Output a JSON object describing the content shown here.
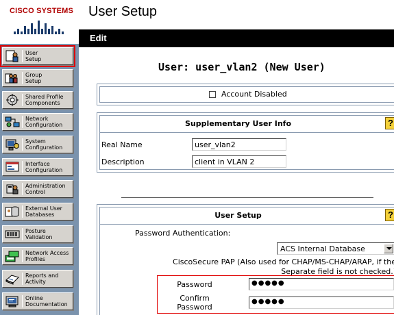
{
  "app": {
    "logo_text": "Cisco Systems",
    "page_title": "User Setup",
    "menu_edit": "Edit"
  },
  "sidebar": {
    "items": [
      {
        "label": "User\nSetup",
        "icon": "user-setup-icon",
        "active": true
      },
      {
        "label": "Group\nSetup",
        "icon": "group-setup-icon",
        "active": false
      },
      {
        "label": "Shared Profile\nComponents",
        "icon": "shared-profile-icon",
        "active": false
      },
      {
        "label": "Network\nConfiguration",
        "icon": "network-config-icon",
        "active": false
      },
      {
        "label": "System\nConfiguration",
        "icon": "system-config-icon",
        "active": false
      },
      {
        "label": "Interface\nConfiguration",
        "icon": "interface-config-icon",
        "active": false
      },
      {
        "label": "Administration\nControl",
        "icon": "admin-control-icon",
        "active": false
      },
      {
        "label": "External User\nDatabases",
        "icon": "external-db-icon",
        "active": false
      },
      {
        "label": "Posture\nValidation",
        "icon": "posture-validation-icon",
        "active": false
      },
      {
        "label": "Network Access\nProfiles",
        "icon": "network-access-icon",
        "active": false
      },
      {
        "label": "Reports and\nActivity",
        "icon": "reports-icon",
        "active": false
      },
      {
        "label": "Online\nDocumentation",
        "icon": "online-docs-icon",
        "active": false
      }
    ]
  },
  "main": {
    "user_heading": "User: user_vlan2 (New User)",
    "account_disabled_label": "Account Disabled",
    "account_disabled_checked": false,
    "supplementary": {
      "title": "Supplementary User Info",
      "real_name_label": "Real Name",
      "real_name_value": "user_vlan2",
      "description_label": "Description",
      "description_value": "client in VLAN 2"
    },
    "user_setup": {
      "title": "User Setup",
      "password_auth_label": "Password Authentication:",
      "database_selected": "ACS Internal Database",
      "pap_note": "CiscoSecure PAP (Also used for CHAP/MS-CHAP/ARAP, if the Separate field is not checked.)",
      "password_label": "Password",
      "password_value": "●●●●●",
      "confirm_label": "Confirm\nPassword",
      "confirm_value": "●●●●●"
    },
    "help_glyph": "?"
  },
  "colors": {
    "sidebar_bg": "#7b93ad",
    "menubar_bg": "#000000",
    "highlight": "#e00000",
    "help_bg": "#f4d13a",
    "logo_red": "#b00000"
  }
}
